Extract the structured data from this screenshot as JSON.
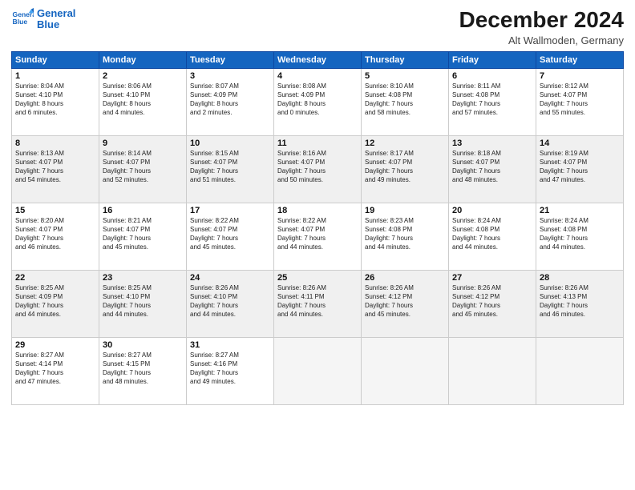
{
  "header": {
    "logo_line1": "General",
    "logo_line2": "Blue",
    "month": "December 2024",
    "location": "Alt Wallmoden, Germany"
  },
  "weekdays": [
    "Sunday",
    "Monday",
    "Tuesday",
    "Wednesday",
    "Thursday",
    "Friday",
    "Saturday"
  ],
  "weeks": [
    [
      {
        "day": "1",
        "info": "Sunrise: 8:04 AM\nSunset: 4:10 PM\nDaylight: 8 hours\nand 6 minutes."
      },
      {
        "day": "2",
        "info": "Sunrise: 8:06 AM\nSunset: 4:10 PM\nDaylight: 8 hours\nand 4 minutes."
      },
      {
        "day": "3",
        "info": "Sunrise: 8:07 AM\nSunset: 4:09 PM\nDaylight: 8 hours\nand 2 minutes."
      },
      {
        "day": "4",
        "info": "Sunrise: 8:08 AM\nSunset: 4:09 PM\nDaylight: 8 hours\nand 0 minutes."
      },
      {
        "day": "5",
        "info": "Sunrise: 8:10 AM\nSunset: 4:08 PM\nDaylight: 7 hours\nand 58 minutes."
      },
      {
        "day": "6",
        "info": "Sunrise: 8:11 AM\nSunset: 4:08 PM\nDaylight: 7 hours\nand 57 minutes."
      },
      {
        "day": "7",
        "info": "Sunrise: 8:12 AM\nSunset: 4:07 PM\nDaylight: 7 hours\nand 55 minutes."
      }
    ],
    [
      {
        "day": "8",
        "info": "Sunrise: 8:13 AM\nSunset: 4:07 PM\nDaylight: 7 hours\nand 54 minutes."
      },
      {
        "day": "9",
        "info": "Sunrise: 8:14 AM\nSunset: 4:07 PM\nDaylight: 7 hours\nand 52 minutes."
      },
      {
        "day": "10",
        "info": "Sunrise: 8:15 AM\nSunset: 4:07 PM\nDaylight: 7 hours\nand 51 minutes."
      },
      {
        "day": "11",
        "info": "Sunrise: 8:16 AM\nSunset: 4:07 PM\nDaylight: 7 hours\nand 50 minutes."
      },
      {
        "day": "12",
        "info": "Sunrise: 8:17 AM\nSunset: 4:07 PM\nDaylight: 7 hours\nand 49 minutes."
      },
      {
        "day": "13",
        "info": "Sunrise: 8:18 AM\nSunset: 4:07 PM\nDaylight: 7 hours\nand 48 minutes."
      },
      {
        "day": "14",
        "info": "Sunrise: 8:19 AM\nSunset: 4:07 PM\nDaylight: 7 hours\nand 47 minutes."
      }
    ],
    [
      {
        "day": "15",
        "info": "Sunrise: 8:20 AM\nSunset: 4:07 PM\nDaylight: 7 hours\nand 46 minutes."
      },
      {
        "day": "16",
        "info": "Sunrise: 8:21 AM\nSunset: 4:07 PM\nDaylight: 7 hours\nand 45 minutes."
      },
      {
        "day": "17",
        "info": "Sunrise: 8:22 AM\nSunset: 4:07 PM\nDaylight: 7 hours\nand 45 minutes."
      },
      {
        "day": "18",
        "info": "Sunrise: 8:22 AM\nSunset: 4:07 PM\nDaylight: 7 hours\nand 44 minutes."
      },
      {
        "day": "19",
        "info": "Sunrise: 8:23 AM\nSunset: 4:08 PM\nDaylight: 7 hours\nand 44 minutes."
      },
      {
        "day": "20",
        "info": "Sunrise: 8:24 AM\nSunset: 4:08 PM\nDaylight: 7 hours\nand 44 minutes."
      },
      {
        "day": "21",
        "info": "Sunrise: 8:24 AM\nSunset: 4:08 PM\nDaylight: 7 hours\nand 44 minutes."
      }
    ],
    [
      {
        "day": "22",
        "info": "Sunrise: 8:25 AM\nSunset: 4:09 PM\nDaylight: 7 hours\nand 44 minutes."
      },
      {
        "day": "23",
        "info": "Sunrise: 8:25 AM\nSunset: 4:10 PM\nDaylight: 7 hours\nand 44 minutes."
      },
      {
        "day": "24",
        "info": "Sunrise: 8:26 AM\nSunset: 4:10 PM\nDaylight: 7 hours\nand 44 minutes."
      },
      {
        "day": "25",
        "info": "Sunrise: 8:26 AM\nSunset: 4:11 PM\nDaylight: 7 hours\nand 44 minutes."
      },
      {
        "day": "26",
        "info": "Sunrise: 8:26 AM\nSunset: 4:12 PM\nDaylight: 7 hours\nand 45 minutes."
      },
      {
        "day": "27",
        "info": "Sunrise: 8:26 AM\nSunset: 4:12 PM\nDaylight: 7 hours\nand 45 minutes."
      },
      {
        "day": "28",
        "info": "Sunrise: 8:26 AM\nSunset: 4:13 PM\nDaylight: 7 hours\nand 46 minutes."
      }
    ],
    [
      {
        "day": "29",
        "info": "Sunrise: 8:27 AM\nSunset: 4:14 PM\nDaylight: 7 hours\nand 47 minutes."
      },
      {
        "day": "30",
        "info": "Sunrise: 8:27 AM\nSunset: 4:15 PM\nDaylight: 7 hours\nand 48 minutes."
      },
      {
        "day": "31",
        "info": "Sunrise: 8:27 AM\nSunset: 4:16 PM\nDaylight: 7 hours\nand 49 minutes."
      },
      {
        "day": "",
        "info": ""
      },
      {
        "day": "",
        "info": ""
      },
      {
        "day": "",
        "info": ""
      },
      {
        "day": "",
        "info": ""
      }
    ]
  ]
}
